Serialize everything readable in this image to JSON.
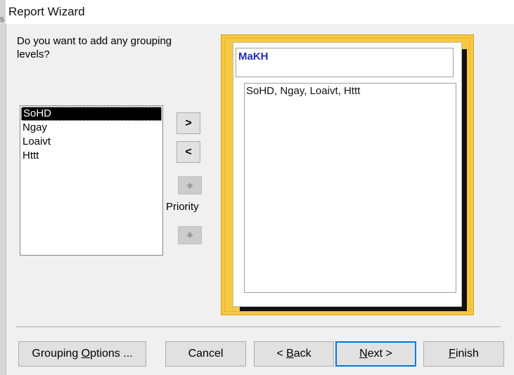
{
  "window": {
    "title": "Report Wizard",
    "side_glyph": "s"
  },
  "question": "Do you want to add any grouping levels?",
  "fields": {
    "items": [
      "SoHD",
      "Ngay",
      "Loaivt",
      "Httt"
    ],
    "selected": "SoHD"
  },
  "move_buttons": {
    "add": ">",
    "remove": "<"
  },
  "priority": {
    "label": "Priority",
    "up_icon": "arrow-up-icon",
    "down_icon": "arrow-down-icon"
  },
  "preview": {
    "group_level": "MaKH",
    "detail_fields": "SoHD, Ngay, Loaivt, Httt",
    "frame_color": "#f7c842"
  },
  "buttons": {
    "grouping_options": {
      "prefix": "Grouping ",
      "accel": "O",
      "suffix": "ptions ..."
    },
    "cancel": "Cancel",
    "back": {
      "prefix": "< ",
      "accel": "B",
      "suffix": "ack"
    },
    "next": {
      "accel": "N",
      "suffix": "ext >"
    },
    "finish": {
      "accel": "F",
      "suffix": "inish"
    }
  }
}
